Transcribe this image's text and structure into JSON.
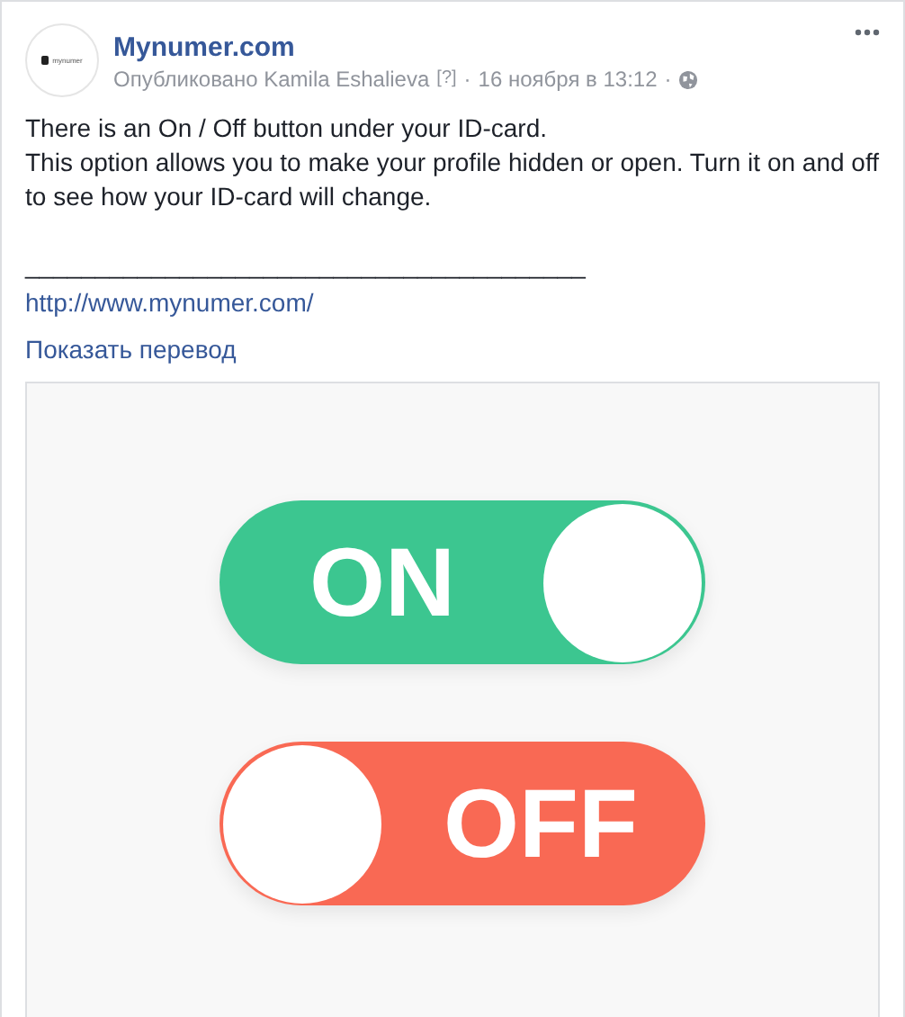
{
  "post": {
    "avatar_logo": "mynumer",
    "page_name": "Mynumer.com",
    "published_by": "Опубликовано Kamila Eshalieva",
    "help_mark": "[?]",
    "separator": "·",
    "date": "16 ноября в 13:12",
    "text_lines": [
      "There is an On / Off button under your ID-card.",
      "This option allows you to make your profile hidden or open. Turn it on and off to see how your ID-card will change."
    ],
    "divider_text": "________________________________________",
    "link": "http://www.mynumer.com/",
    "translate_link": "Показать перевод",
    "image": {
      "toggles": [
        {
          "label": "ON",
          "on": true
        },
        {
          "label": "OFF",
          "on": false
        }
      ]
    }
  }
}
